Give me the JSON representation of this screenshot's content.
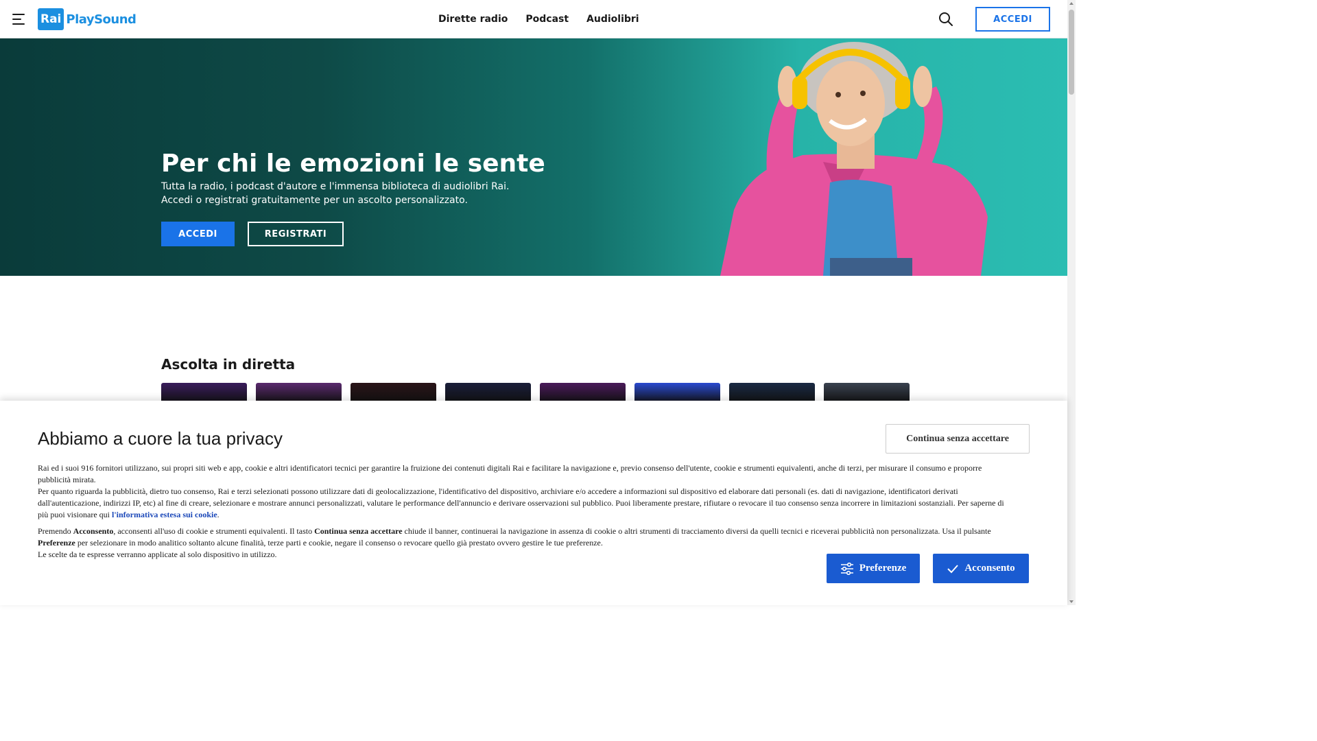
{
  "header": {
    "logo_rai": "Rai",
    "logo_name": "PlaySound",
    "nav": [
      "Dirette radio",
      "Podcast",
      "Audiolibri"
    ],
    "login": "ACCEDI"
  },
  "hero": {
    "title": "Per chi le emozioni le sente",
    "subtitle_line1": "Tutta la radio, i podcast d'autore e l'immensa biblioteca di audiolibri Rai.",
    "subtitle_line2": "Accedi o registrati gratuitamente per un ascolto personalizzato.",
    "login": "ACCEDI",
    "register": "REGISTRATI"
  },
  "live": {
    "title": "Ascolta in diretta",
    "card_colors": [
      "#3a1c5c",
      "#5a2a6e",
      "#2a1418",
      "#1a1e3a",
      "#4a1a5a",
      "#2a4ad0",
      "#1a2a44",
      "#3a4250"
    ]
  },
  "cookie": {
    "title": "Abbiamo a cuore la tua privacy",
    "continue_label": "Continua senza accettare",
    "p1": "Rai ed i suoi 916 fornitori utilizzano, sui propri siti web e app, cookie e altri identificatori tecnici per garantire la fruizione dei contenuti digitali Rai e facilitare la navigazione e, previo consenso dell'utente, cookie e strumenti equivalenti, anche di terzi, per misurare il consumo e proporre pubblicità mirata.",
    "p2": "Per quanto riguarda la pubblicità, dietro tuo consenso, Rai e terzi selezionati possono utilizzare dati di geolocalizzazione, l'identificativo del dispositivo, archiviare e/o accedere a informazioni sul dispositivo ed elaborare dati personali (es. dati di navigazione, identificatori derivati dall'autenticazione, indirizzi IP, etc) al fine di creare, selezionare e mostrare annunci personalizzati, valutare le performance dell'annuncio e derivare osservazioni sul pubblico. Puoi liberamente prestare, rifiutare o revocare il tuo consenso senza incorrere in limitazioni sostanziali. Per saperne di più puoi visionare qui",
    "p2_link": "l'informativa estesa sui cookie",
    "p3_a": "Premendo",
    "p3_b": "Acconsento",
    "p3_c": ", acconsenti all'uso di cookie e strumenti equivalenti. Il tasto",
    "p3_d": "Continua senza accettare",
    "p3_e": "chiude il banner, continuerai la navigazione in assenza di cookie o altri strumenti di tracciamento diversi da quelli tecnici e riceverai pubblicità non personalizzata. Usa il pulsante",
    "p3_f": "Preferenze",
    "p3_g": "per selezionare in modo analitico soltanto alcune finalità, terze parti e cookie, negare il consenso o revocare quello già prestato ovvero gestire le tue preferenze.",
    "p4": "Le scelte da te espresse verranno applicate al solo dispositivo in utilizzo.",
    "pref_label": "Preferenze",
    "accept_label": "Acconsento"
  }
}
